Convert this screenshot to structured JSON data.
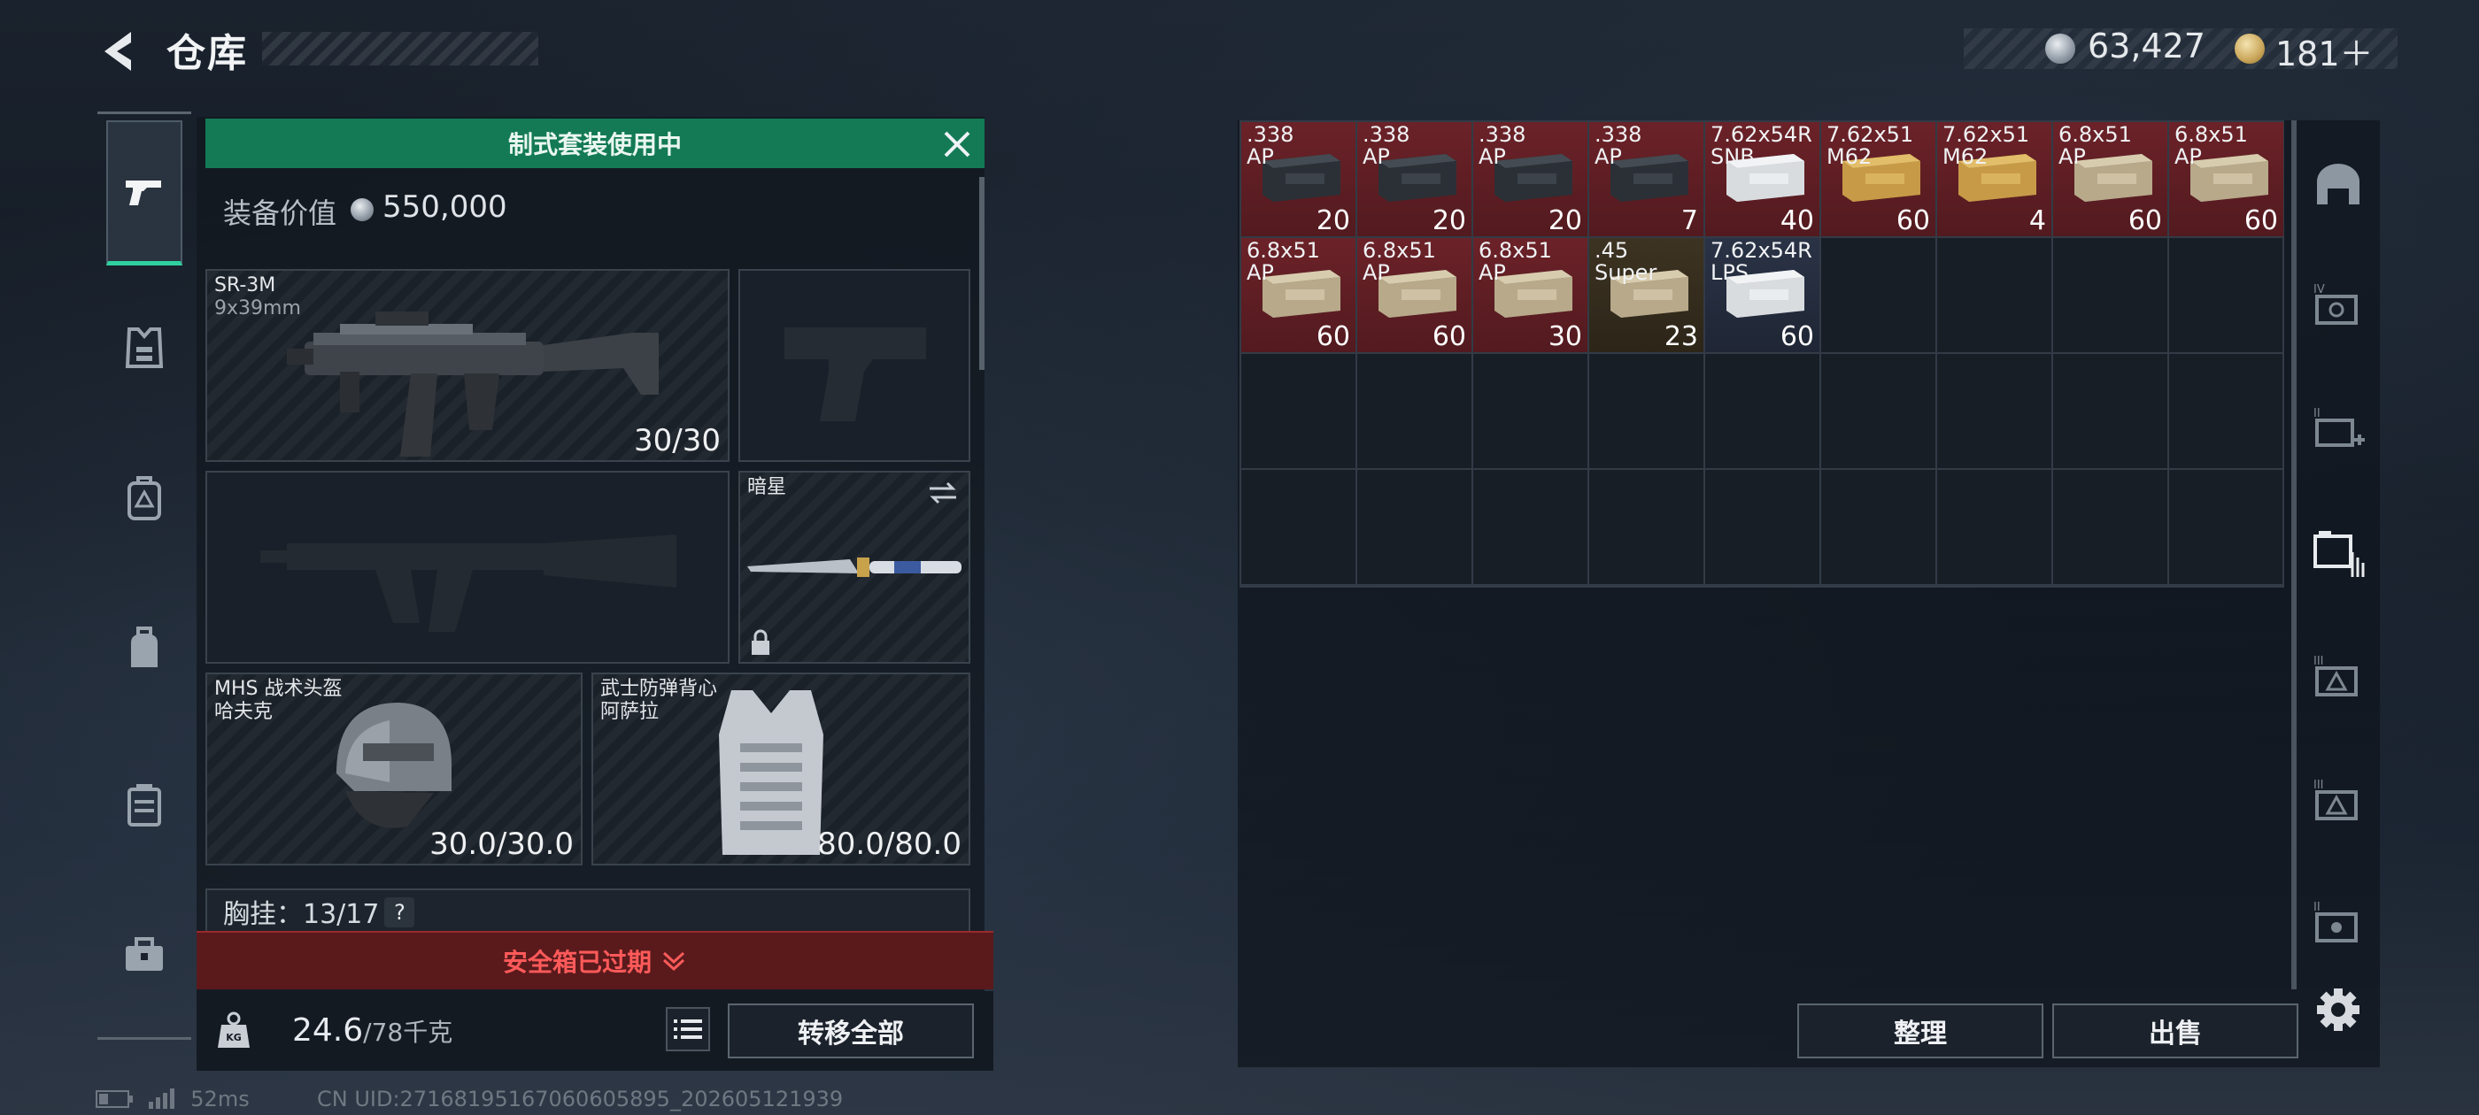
{
  "header": {
    "title": "仓库",
    "currency_silver": "63,427",
    "currency_gold": "181＋"
  },
  "sidebar": {
    "items": [
      {
        "name": "weapons",
        "icon": "pistol-icon",
        "active": true
      },
      {
        "name": "armor",
        "icon": "vest-icon",
        "active": false
      },
      {
        "name": "backpack-a",
        "icon": "backpack-icon",
        "active": false
      },
      {
        "name": "backpack-b",
        "icon": "bag-icon",
        "active": false
      },
      {
        "name": "container",
        "icon": "case-icon",
        "active": false
      },
      {
        "name": "toolbox",
        "icon": "toolbox-icon",
        "active": false
      }
    ]
  },
  "loadout": {
    "kit_banner": "制式套装使用中",
    "equip_value_label": "装备价值",
    "equip_value": "550,000",
    "primary": {
      "name": "SR-3M",
      "caliber": "9x39mm",
      "ammo": "30/30"
    },
    "melee": {
      "name": "暗星"
    },
    "helmet": {
      "name": "MHS 战术头盔",
      "sub": "哈夫克",
      "durability": "30.0/30.0"
    },
    "vest": {
      "name": "武士防弹背心",
      "sub": "阿萨拉",
      "durability": "80.0/80.0"
    },
    "chest_rig_label": "胸挂：",
    "chest_rig_count": "13/17",
    "chest_rig_help": "?",
    "safe_box_status": "安全箱已过期",
    "weight_current": "24.6",
    "weight_max": "/78千克",
    "transfer_all": "转移全部"
  },
  "stash": {
    "items": [
      {
        "name": ".338\nAP",
        "qty": "20",
        "tone": "red",
        "box": "dark"
      },
      {
        "name": ".338\nAP",
        "qty": "20",
        "tone": "red",
        "box": "dark"
      },
      {
        "name": ".338\nAP",
        "qty": "20",
        "tone": "red",
        "box": "dark"
      },
      {
        "name": ".338\nAP",
        "qty": "7",
        "tone": "red",
        "box": "dark"
      },
      {
        "name": "7.62x54R\nSNB",
        "qty": "40",
        "tone": "red",
        "box": "white"
      },
      {
        "name": "7.62x51\nM62",
        "qty": "60",
        "tone": "red",
        "box": "tan"
      },
      {
        "name": "7.62x51\nM62",
        "qty": "4",
        "tone": "red",
        "box": "tan"
      },
      {
        "name": "6.8x51\nAP",
        "qty": "60",
        "tone": "red",
        "box": "beige"
      },
      {
        "name": "6.8x51\nAP",
        "qty": "60",
        "tone": "red",
        "box": "beige"
      },
      {
        "name": "6.8x51\nAP",
        "qty": "60",
        "tone": "red",
        "box": "beige"
      },
      {
        "name": "6.8x51\nAP",
        "qty": "60",
        "tone": "red",
        "box": "beige"
      },
      {
        "name": "6.8x51\nAP",
        "qty": "30",
        "tone": "red",
        "box": "beige"
      },
      {
        "name": ".45\nSuper",
        "qty": "23",
        "tone": "gold",
        "box": "beige"
      },
      {
        "name": "7.62x54R\nLPS",
        "qty": "60",
        "tone": "blue",
        "box": "white"
      }
    ],
    "sort_label": "整理",
    "sell_label": "出售"
  },
  "footer": {
    "ping": "52ms",
    "uid": "CN UID:27168195167060605895_202605121939"
  },
  "colors": {
    "kit_green": "#137a55",
    "safe_red": "#ff5a5a",
    "active_tab": "#2fd0a0",
    "rarity_red": "#6b2228",
    "rarity_gold": "#3d3322",
    "rarity_blue": "#2a3346"
  }
}
